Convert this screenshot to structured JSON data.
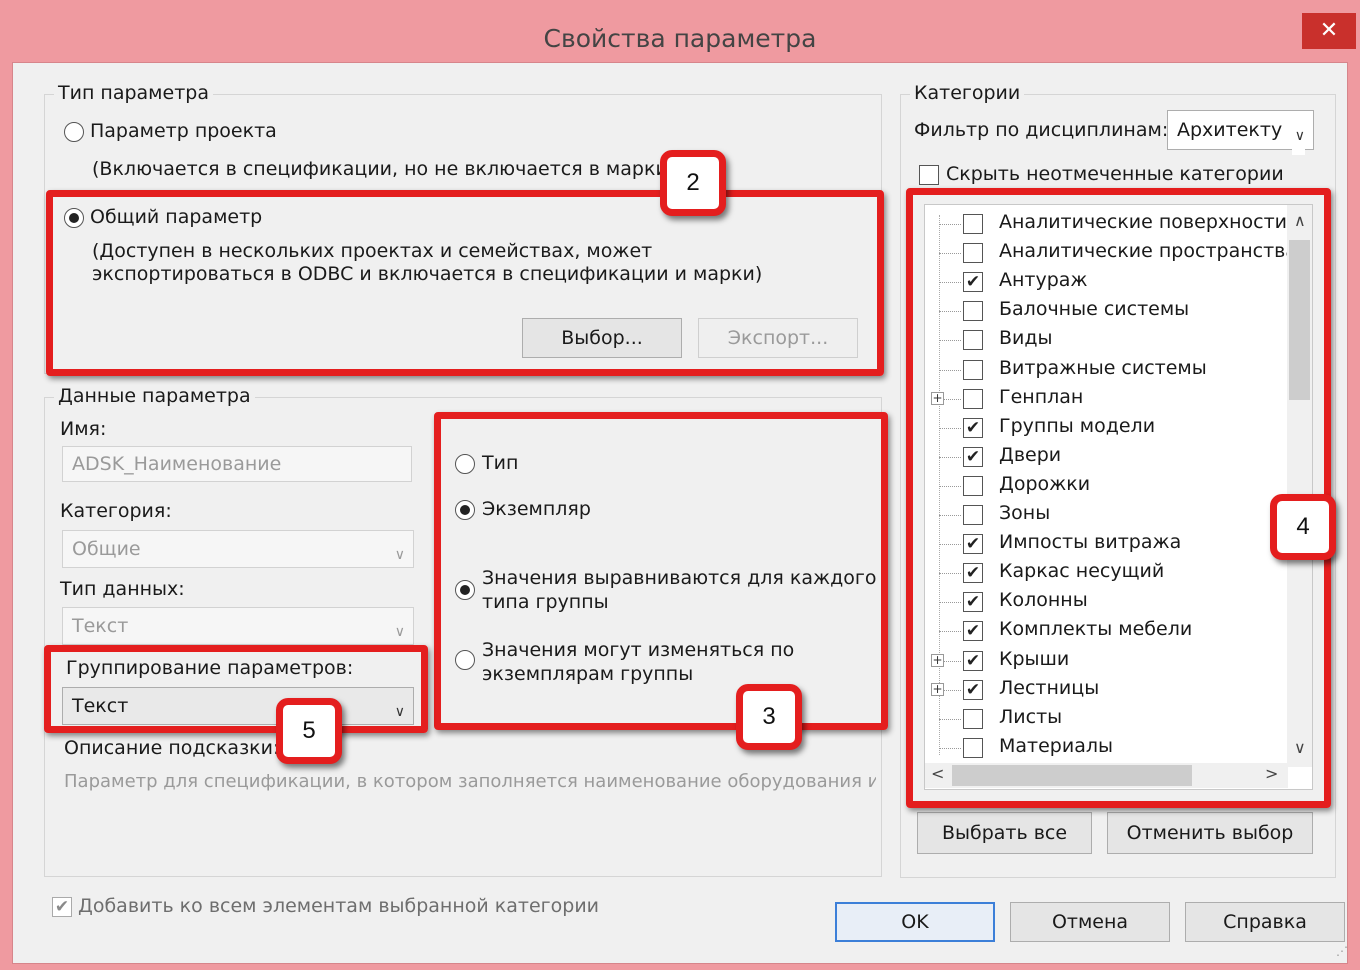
{
  "window": {
    "title": "Свойства параметра",
    "close_glyph": "✕"
  },
  "param_type": {
    "legend": "Тип параметра",
    "project_label": "Параметр проекта",
    "project_desc": "(Включается в спецификации, но не включается в марки)",
    "shared_label": "Общий параметр",
    "shared_desc_1": "(Доступен в нескольких проектах и семействах, может",
    "shared_desc_2": "экспортироваться в ODBC и включается в спецификации и марки)",
    "select_button": "Выбор...",
    "export_button": "Экспорт..."
  },
  "param_data": {
    "legend": "Данные параметра",
    "name_label": "Имя:",
    "name_value": "ADSK_Наименование",
    "category_label": "Категория:",
    "category_value": "Общие",
    "datatype_label": "Тип данных:",
    "datatype_value": "Текст",
    "grouping_label": "Группирование параметров:",
    "grouping_value": "Текст",
    "tooltip_label": "Описание подсказки:",
    "tooltip_value": "Параметр для спецификации, в котором заполняется наименование оборудования и...",
    "type_label": "Тип",
    "instance_label": "Экземпляр",
    "aligned_1": "Значения выравниваются для каждого",
    "aligned_2": "типа группы",
    "vary_1": "Значения могут изменяться по",
    "vary_2": "экземплярам группы"
  },
  "categories": {
    "legend": "Категории",
    "filter_label": "Фильтр по дисциплинам:",
    "filter_value": "Архитекту",
    "hide_unchecked_label": "Скрыть неотмеченные категории",
    "items": [
      {
        "label": "Аналитические поверхности",
        "checked": false,
        "expandable": false
      },
      {
        "label": "Аналитические пространства",
        "checked": false,
        "expandable": false
      },
      {
        "label": "Антураж",
        "checked": true,
        "expandable": false
      },
      {
        "label": "Балочные системы",
        "checked": false,
        "expandable": false
      },
      {
        "label": "Виды",
        "checked": false,
        "expandable": false
      },
      {
        "label": "Витражные системы",
        "checked": false,
        "expandable": false
      },
      {
        "label": "Генплан",
        "checked": false,
        "expandable": true
      },
      {
        "label": "Группы модели",
        "checked": true,
        "expandable": false
      },
      {
        "label": "Двери",
        "checked": true,
        "expandable": false
      },
      {
        "label": "Дорожки",
        "checked": false,
        "expandable": false
      },
      {
        "label": "Зоны",
        "checked": false,
        "expandable": false
      },
      {
        "label": "Импосты витража",
        "checked": true,
        "expandable": false
      },
      {
        "label": "Каркас несущий",
        "checked": true,
        "expandable": false
      },
      {
        "label": "Колонны",
        "checked": true,
        "expandable": false
      },
      {
        "label": "Комплекты мебели",
        "checked": true,
        "expandable": false
      },
      {
        "label": "Крыши",
        "checked": true,
        "expandable": true
      },
      {
        "label": "Лестницы",
        "checked": true,
        "expandable": true
      },
      {
        "label": "Листы",
        "checked": false,
        "expandable": false
      },
      {
        "label": "Материалы",
        "checked": false,
        "expandable": false
      }
    ],
    "select_all_button": "Выбрать все",
    "deselect_button": "Отменить выбор"
  },
  "footer": {
    "add_all_label": "Добавить ко всем элементам выбранной категории",
    "ok_button": "OK",
    "cancel_button": "Отмена",
    "help_button": "Справка"
  },
  "annotations": {
    "badge_2": "2",
    "badge_3": "3",
    "badge_4": "4",
    "badge_5": "5"
  },
  "colors": {
    "frame": "#ef9aa0",
    "highlight_red": "#e41e1e",
    "close_button": "#c9302c"
  }
}
